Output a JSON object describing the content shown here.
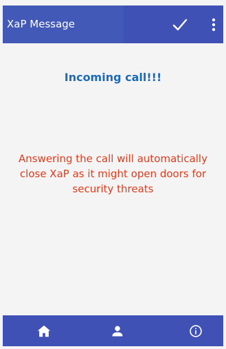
{
  "app_bar": {
    "title": "XaP Message",
    "confirm_icon": "check-icon",
    "menu_icon": "more-vert-icon",
    "color": "#3f51b5"
  },
  "content": {
    "heading": "Incoming call!!!",
    "heading_color": "#1e6bb8",
    "warning_lines": [
      "Answering the call will automatically",
      "close XaP as it might open doors for",
      "security threats"
    ],
    "warning_color": "#e43a1c"
  },
  "bottom_nav": {
    "items": [
      {
        "icon": "home-icon"
      },
      {
        "icon": "person-icon"
      },
      {
        "icon": "info-icon"
      }
    ],
    "color": "#3f51b5"
  }
}
